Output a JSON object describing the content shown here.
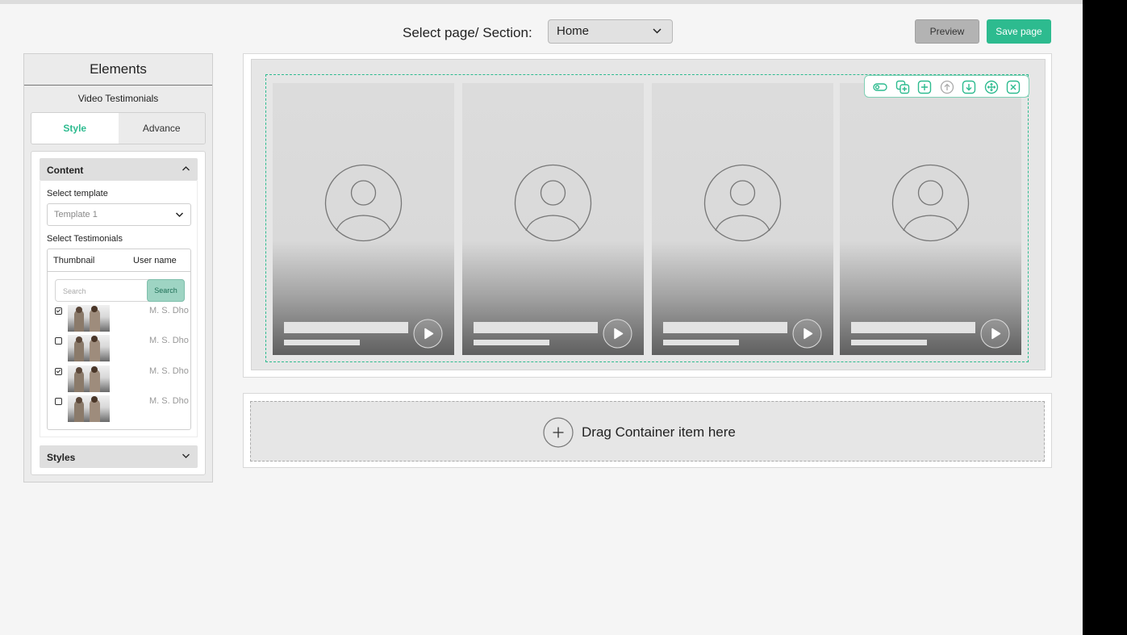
{
  "header": {
    "select_label": "Select page/ Section:",
    "selected_page": "Home",
    "preview_label": "Preview",
    "save_label": "Save page"
  },
  "sidebar": {
    "title": "Elements",
    "subtitle": "Video Testimonials",
    "tabs": [
      {
        "label": "Style",
        "active": true
      },
      {
        "label": "Advance",
        "active": false
      }
    ],
    "content_section": {
      "title": "Content",
      "expanded": true,
      "template_label": "Select template",
      "template_value": "Template 1",
      "testimonials_label": "Select Testimonials",
      "columns": [
        "Thumbnail",
        "User name"
      ],
      "search_placeholder": "Search",
      "search_button": "Search",
      "rows": [
        {
          "checked": true,
          "user_name": "M. S. Dho"
        },
        {
          "checked": false,
          "user_name": "M. S. Dho"
        },
        {
          "checked": true,
          "user_name": "M. S. Dho"
        },
        {
          "checked": false,
          "user_name": "M. S. Dho"
        }
      ]
    },
    "styles_section": {
      "title": "Styles",
      "expanded": false
    }
  },
  "canvas": {
    "cards_count": 4,
    "toolbar_icons": [
      "toggle-icon",
      "duplicate-icon",
      "add-icon",
      "move-up-icon",
      "move-down-icon",
      "drag-move-icon",
      "delete-icon"
    ],
    "drop_zone_text": "Drag Container item here"
  },
  "colors": {
    "accent": "#2dbb8f",
    "preview_bg": "#b3b3b3",
    "canvas_bg": "#e6e6e6",
    "app_bg": "#f5f5f5"
  }
}
